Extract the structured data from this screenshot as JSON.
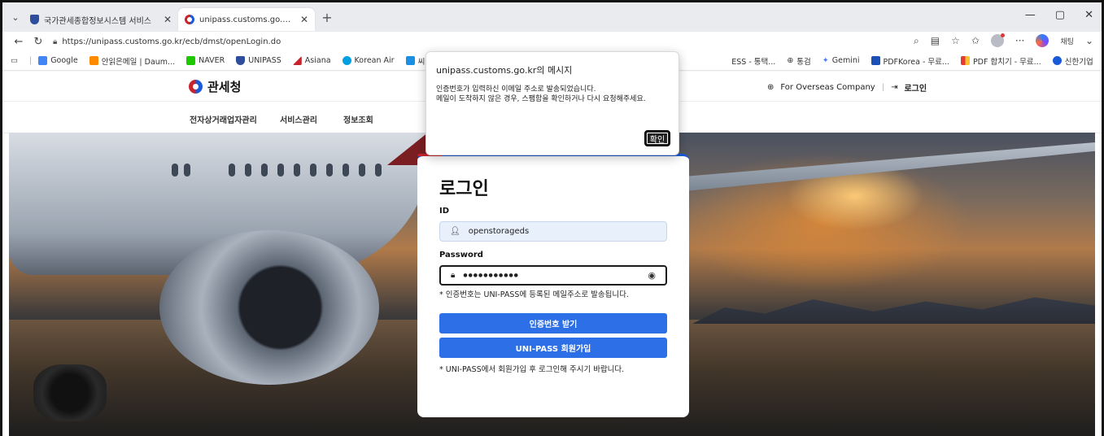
{
  "browser": {
    "tabs": [
      {
        "title": "국가관세종합정보시스템 서비스",
        "active": false
      },
      {
        "title": "unipass.customs.go.kr/ecb/dmst/c",
        "active": true
      }
    ],
    "url": "https://unipass.customs.go.kr/ecb/dmst/openLogin.do",
    "profile_label": "채팅",
    "bookmarks": [
      {
        "label": "Google",
        "color": "#4285f4"
      },
      {
        "label": "안읽은메일 | Daum...",
        "color": "#ff8a00"
      },
      {
        "label": "NAVER",
        "color": "#1ec800"
      },
      {
        "label": "UNIPASS",
        "color": "#2e4d9c"
      },
      {
        "label": "Asiana",
        "color": "#c6242a"
      },
      {
        "label": "Korean Air",
        "color": "#00a0e0"
      },
      {
        "label": "씨엘HS",
        "color": "#1a8fe3"
      },
      {
        "label": "ESS - 통택...",
        "color": "#888888"
      },
      {
        "label": "통검",
        "color": "#555555"
      },
      {
        "label": "Gemini",
        "color": "#4a7cf7"
      },
      {
        "label": "PDFKorea - 무료...",
        "color": "#1a4fb5"
      },
      {
        "label": "PDF 합치기 - 무료...",
        "color": "#e53935"
      },
      {
        "label": "신한기업",
        "color": "#1a5ad8"
      }
    ]
  },
  "site": {
    "brand": "관세청",
    "overseas_link": "For Overseas Company",
    "login_link": "로그인",
    "nav": [
      "전자상거래업자관리",
      "서비스관리",
      "정보조회"
    ]
  },
  "login": {
    "title": "로그인",
    "id_label": "ID",
    "id_value": "openstorageds",
    "password_label": "Password",
    "password_value": "●●●●●●●●●●●",
    "hint1": "* 인증번호는 UNI-PASS에 등록된 메일주소로 발송됩니다.",
    "get_code_button": "인증번호 받기",
    "signup_button": "UNI-PASS 회원가입",
    "hint2": "* UNI-PASS에서 회원가입 후 로그인해 주시기 바랍니다."
  },
  "dialog": {
    "title": "unipass.customs.go.kr의 메시지",
    "line1": "인증번호가 입력하신 이메일 주소로 발송되었습니다.",
    "line2": "메일이 도착하지 않은 경우, 스팸함을 확인하거나 다시 요청해주세요.",
    "ok_button": "확인"
  }
}
